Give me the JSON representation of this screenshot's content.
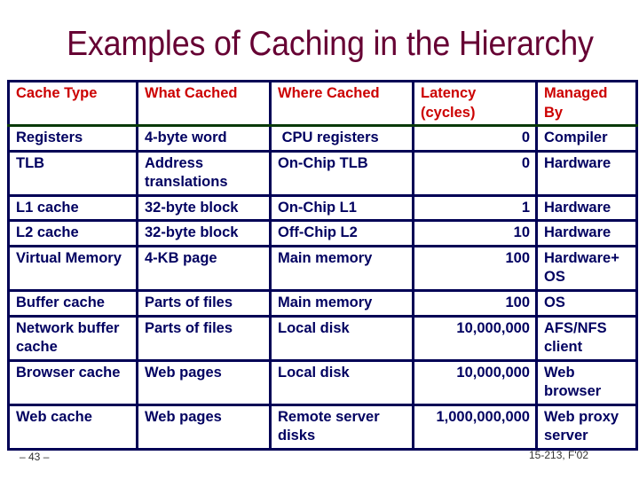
{
  "slide": {
    "title": "Examples of Caching in the Hierarchy",
    "page_number": "– 43 –",
    "course": "15-213, F'02"
  },
  "colors": {
    "title": "#660033",
    "header_text": "#cc0000",
    "body_text": "#000060",
    "grid": "#000055",
    "header_separator": "#0a3a0a"
  },
  "table": {
    "headers": [
      "Cache Type",
      "What Cached",
      "Where Cached",
      "Latency (cycles)",
      "Managed By"
    ],
    "rows": [
      [
        "Registers",
        "4-byte word",
        " CPU registers",
        "0",
        "Compiler"
      ],
      [
        "TLB",
        "Address translations",
        "On-Chip TLB",
        "0",
        "Hardware"
      ],
      [
        "L1 cache",
        "32-byte block",
        "On-Chip L1",
        "1",
        "Hardware"
      ],
      [
        "L2 cache",
        "32-byte block",
        "Off-Chip L2",
        "10",
        "Hardware"
      ],
      [
        "Virtual Memory",
        "4-KB page",
        "Main memory",
        "100",
        "Hardware+ OS"
      ],
      [
        "Buffer cache",
        "Parts of files",
        "Main memory",
        "100",
        "OS"
      ],
      [
        "Network buffer cache",
        "Parts of files",
        "Local disk",
        "10,000,000",
        "AFS/NFS client"
      ],
      [
        "Browser cache",
        "Web pages",
        "Local disk",
        "10,000,000",
        "Web browser"
      ],
      [
        "Web cache",
        "Web pages",
        "Remote server disks",
        "1,000,000,000",
        "Web proxy server"
      ]
    ]
  }
}
